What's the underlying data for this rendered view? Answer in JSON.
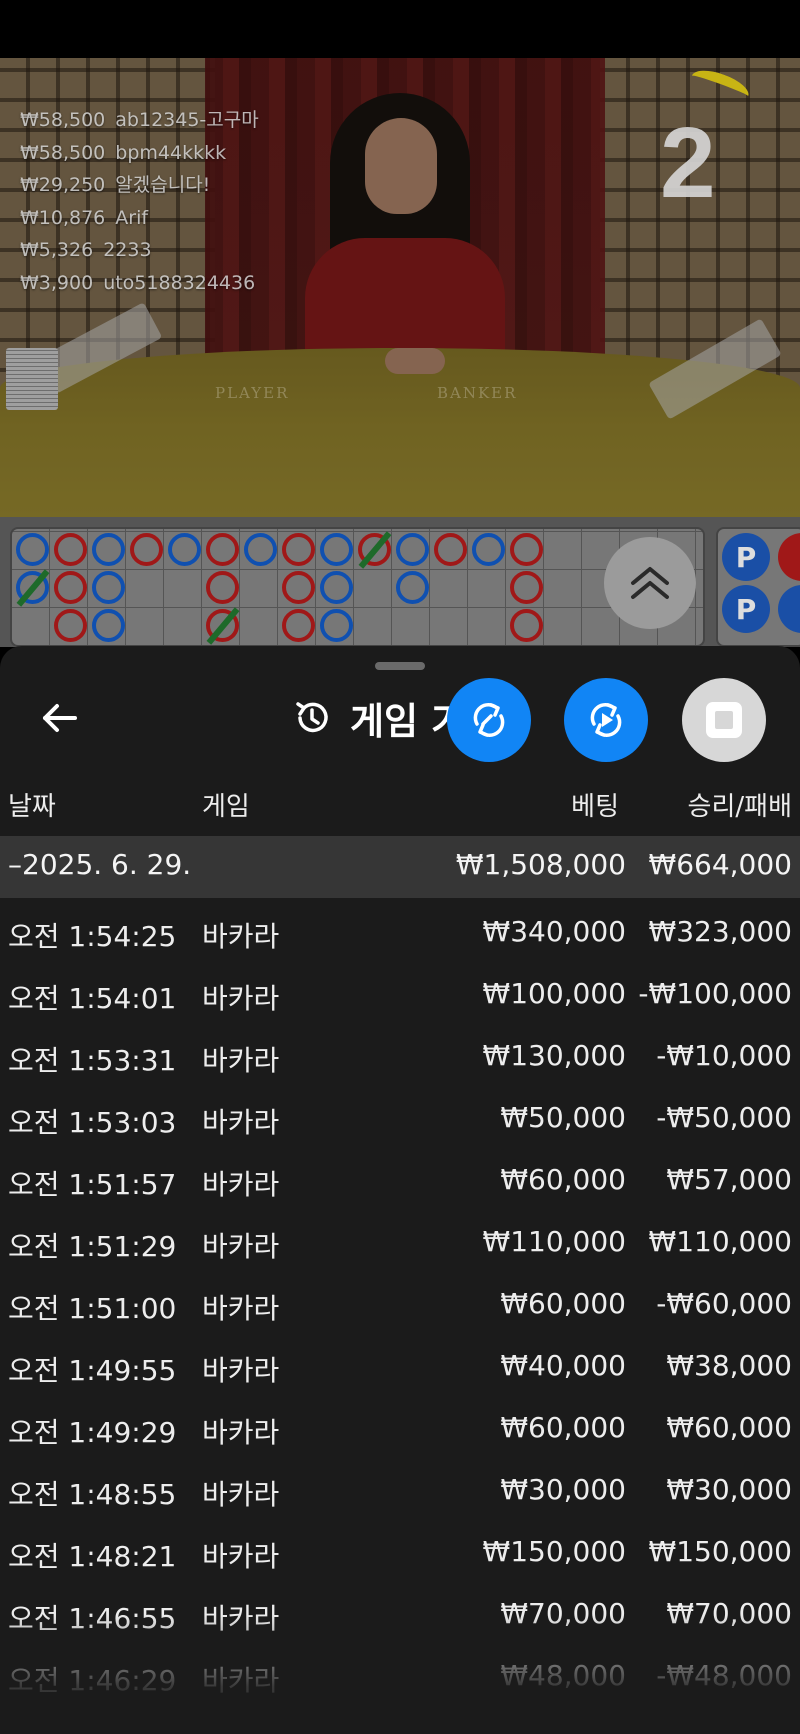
{
  "live_bets": [
    {
      "amount": "₩58,500",
      "user": "ab12345-고구마"
    },
    {
      "amount": "₩58,500",
      "user": "bpm44kkkk"
    },
    {
      "amount": "₩29,250",
      "user": "알겠습니다!"
    },
    {
      "amount": "₩10,876",
      "user": "Arif"
    },
    {
      "amount": "₩5,326",
      "user": "2233"
    },
    {
      "amount": "₩3,900",
      "user": "uto5188324436"
    }
  ],
  "countdown": "2",
  "table_labels": {
    "player": "PLAYER",
    "banker": "BANKER"
  },
  "side_road_label": "P",
  "history": {
    "title": "게임 기",
    "columns": {
      "date": "날짜",
      "game": "게임",
      "bet": "베팅",
      "result": "승리/패배"
    },
    "day": {
      "date": "–2025. 6. 29.",
      "bet": "₩1,508,000",
      "result": "₩664,000"
    },
    "rows": [
      {
        "time": "오전 1:54:25",
        "game": "바카라",
        "bet": "₩340,000",
        "result": "₩323,000"
      },
      {
        "time": "오전 1:54:01",
        "game": "바카라",
        "bet": "₩100,000",
        "result": "-₩100,000"
      },
      {
        "time": "오전 1:53:31",
        "game": "바카라",
        "bet": "₩130,000",
        "result": "-₩10,000"
      },
      {
        "time": "오전 1:53:03",
        "game": "바카라",
        "bet": "₩50,000",
        "result": "-₩50,000"
      },
      {
        "time": "오전 1:51:57",
        "game": "바카라",
        "bet": "₩60,000",
        "result": "₩57,000"
      },
      {
        "time": "오전 1:51:29",
        "game": "바카라",
        "bet": "₩110,000",
        "result": "₩110,000"
      },
      {
        "time": "오전 1:51:00",
        "game": "바카라",
        "bet": "₩60,000",
        "result": "-₩60,000"
      },
      {
        "time": "오전 1:49:55",
        "game": "바카라",
        "bet": "₩40,000",
        "result": "₩38,000"
      },
      {
        "time": "오전 1:49:29",
        "game": "바카라",
        "bet": "₩60,000",
        "result": "₩60,000"
      },
      {
        "time": "오전 1:48:55",
        "game": "바카라",
        "bet": "₩30,000",
        "result": "₩30,000"
      },
      {
        "time": "오전 1:48:21",
        "game": "바카라",
        "bet": "₩150,000",
        "result": "₩150,000"
      },
      {
        "time": "오전 1:46:55",
        "game": "바카라",
        "bet": "₩70,000",
        "result": "₩70,000"
      },
      {
        "time": "오전 1:46:29",
        "game": "바카라",
        "bet": "₩48,000",
        "result": "-₩48,000"
      }
    ]
  },
  "icons": {
    "back": "arrow-left-icon",
    "history": "history-icon",
    "autoplay": "auto-rotate-icon",
    "replay": "replay-play-icon",
    "stop": "stop-icon",
    "collapse": "double-chevron-up-icon"
  },
  "colors": {
    "accent": "#1185f5",
    "banker": "#a01818",
    "player": "#1050b0",
    "tie": "#1e6a2a"
  }
}
